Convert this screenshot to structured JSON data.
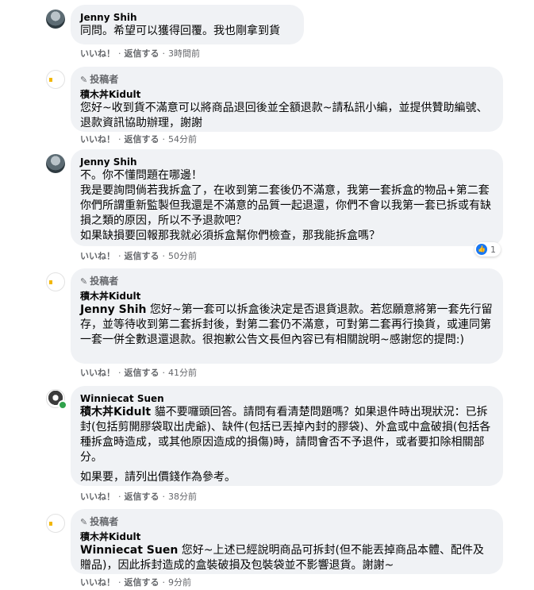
{
  "actions": {
    "like": "いいね！",
    "reply": "返信する",
    "sep": "·"
  },
  "comments": [
    {
      "author": "Jenny Shih",
      "text": "同問。希望可以獲得回覆。我也剛拿到貨",
      "time": "3時間前"
    },
    {
      "badge": "投稿者",
      "author": "積木丼Kidult",
      "text": "您好~收到貨不滿意可以將商品退回後並全額退款~請私訊小編，並提供贊助編號、退款資訊協助辦理，謝謝",
      "time": "54分前",
      "logo_text": "積木丼"
    },
    {
      "author": "Jenny Shih",
      "text": "不。你不懂問題在哪邊！\n我是要詢問倘若我拆盒了，在收到第二套後仍不滿意，我第一套拆盒的物品+第二套你們所謂重新監製但我還是不滿意的品質一起退還，你們不會以我第一套已拆或有缺損之類的原因，所以不予退款吧？\n如果缺損要回報那我就必須拆盒幫你們檢查，那我能拆盒嗎？",
      "time": "50分前",
      "reaction_count": "1"
    },
    {
      "badge": "投稿者",
      "author": "積木丼Kidult",
      "mention": "Jenny Shih",
      "text": " 您好~第一套可以拆盒後決定是否退貨退款。若您願意將第一套先行留存，並等待收到第二套拆封後，對第二套仍不滿意，可對第二套再行換貨，或連同第一套一併全數退還退款。很抱歉公告文長但內容已有相關說明~感謝您的提問:)",
      "time": "41分前",
      "logo_text": "積木丼"
    },
    {
      "author": "Winniecat Suen",
      "mention": "積木丼Kidult",
      "text": " 貓不要囉頭回答。請問有看清楚問題嗎？如果退件時出現狀況：已拆封(包括剪開膠袋取出虎爺)、缺件(包括已丟掉內封的膠袋)、外盒或中盒破損(包括各種拆盒時造成，或其他原因造成的損傷)時，請問會否不予退件，或者要扣除相關部分。",
      "text2": "如果要，請列出價錢作為參考。",
      "time": "38分前"
    },
    {
      "badge": "投稿者",
      "author": "積木丼Kidult",
      "mention": "Winniecat Suen",
      "text": " 您好~上述已經說明商品可拆封(但不能丟掉商品本體、配件及贈品)，因此拆封造成的盒裝破損及包裝袋並不影響退貨。謝謝~",
      "time": "9分前",
      "logo_text": "積木丼"
    }
  ]
}
